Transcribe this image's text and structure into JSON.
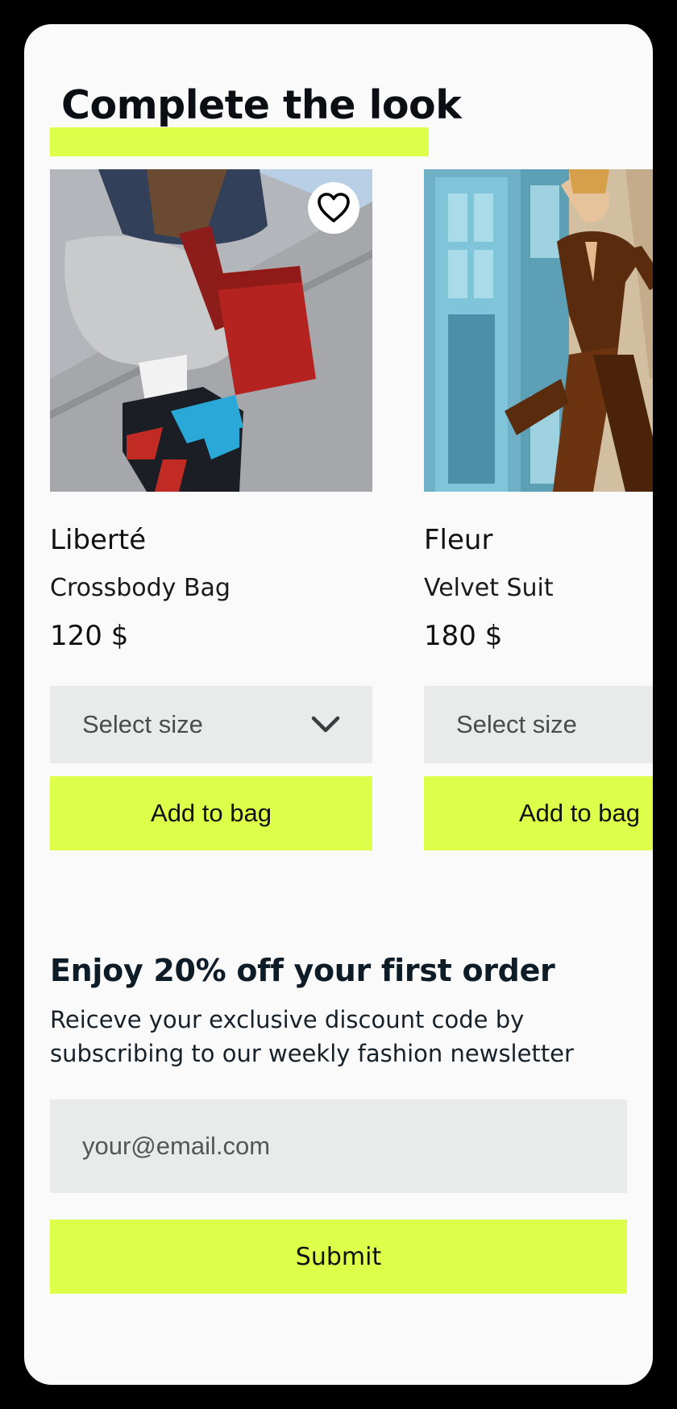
{
  "section": {
    "title": "Complete the look"
  },
  "products": [
    {
      "name": "Liberté",
      "type": "Crossbody Bag",
      "price": "120 $",
      "size_placeholder": "Select size",
      "add_label": "Add to bag",
      "favorite": "heart-outline-icon"
    },
    {
      "name": "Fleur",
      "type": "Velvet Suit",
      "price": "180 $",
      "size_placeholder": "Select size",
      "add_label": "Add to bag"
    }
  ],
  "promo": {
    "title": "Enjoy 20% off your first order",
    "text": "Reiceve your exclusive discount code by subscribing to our weekly fashion newsletter",
    "email_placeholder": "your@email.com",
    "submit_label": "Submit"
  },
  "colors": {
    "accent": "#ddff4a",
    "field_bg": "#e9eaea",
    "page_bg": "#fafafa",
    "frame": "#000000"
  }
}
